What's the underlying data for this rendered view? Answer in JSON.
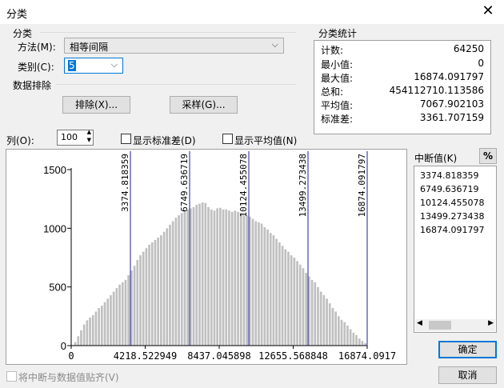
{
  "window": {
    "title": "分类",
    "close_glyph": "✕"
  },
  "classification": {
    "group_label": "分类",
    "method_label": "方法(M):",
    "method_value": "相等间隔",
    "classes_label": "类别(C):",
    "classes_value": "5"
  },
  "exclusion": {
    "group_label": "数据排除",
    "exclude_button": "排除(X)...",
    "sample_button": "采样(G)..."
  },
  "stats": {
    "group_label": "分类统计",
    "rows": [
      {
        "key": "计数:",
        "value": "64250"
      },
      {
        "key": "最小值:",
        "value": "0"
      },
      {
        "key": "最大值:",
        "value": "16874.091797"
      },
      {
        "key": "总和:",
        "value": "454112710.113586"
      },
      {
        "key": "平均值:",
        "value": "7067.902103"
      },
      {
        "key": "标准差:",
        "value": "3361.707159"
      }
    ]
  },
  "columns": {
    "label": "列(O):",
    "value": "100"
  },
  "checkboxes": {
    "show_std": "显示标准差(D)",
    "show_mean": "显示平均值(N)",
    "snap": "将中断与数据值贴齐(V)"
  },
  "breaks": {
    "label": "中断值(K)",
    "percent_button": "%",
    "values": [
      "3374.818359",
      "6749.636719",
      "10124.455078",
      "13499.273438",
      "16874.091797"
    ]
  },
  "buttons": {
    "ok": "确定",
    "cancel": "取消"
  },
  "chart_data": {
    "type": "bar",
    "ylim": [
      0,
      1500
    ],
    "xlim": [
      0,
      16874.0917
    ],
    "y_ticks": [
      "0",
      "500",
      "1000",
      "1500"
    ],
    "x_ticks": [
      "0",
      "4218.522949",
      "8437.045898",
      "12655.568848",
      "16874.0917"
    ],
    "break_lines": [
      3374.818359,
      6749.636719,
      10124.455078,
      13499.273438,
      16874.091797
    ],
    "break_labels": [
      "3374.818359",
      "6749.636719",
      "10124.455078",
      "13499.273438",
      "16874.091797"
    ],
    "values": [
      2,
      30,
      80,
      130,
      180,
      215,
      240,
      260,
      290,
      320,
      340,
      370,
      400,
      430,
      460,
      490,
      520,
      540,
      560,
      600,
      640,
      680,
      730,
      770,
      800,
      830,
      860,
      880,
      900,
      920,
      940,
      970,
      1000,
      1030,
      1060,
      1090,
      1110,
      1130,
      1150,
      1160,
      1170,
      1180,
      1200,
      1210,
      1220,
      1215,
      1180,
      1160,
      1150,
      1170,
      1175,
      1160,
      1160,
      1150,
      1140,
      1150,
      1140,
      1130,
      1110,
      1110,
      1100,
      1080,
      1060,
      1050,
      1040,
      1010,
      990,
      960,
      940,
      910,
      880,
      850,
      820,
      800,
      770,
      750,
      720,
      690,
      660,
      620,
      590,
      560,
      540,
      500,
      460,
      430,
      400,
      360,
      320,
      290,
      250,
      220,
      200,
      170,
      140,
      110,
      90,
      60,
      40,
      20
    ]
  }
}
